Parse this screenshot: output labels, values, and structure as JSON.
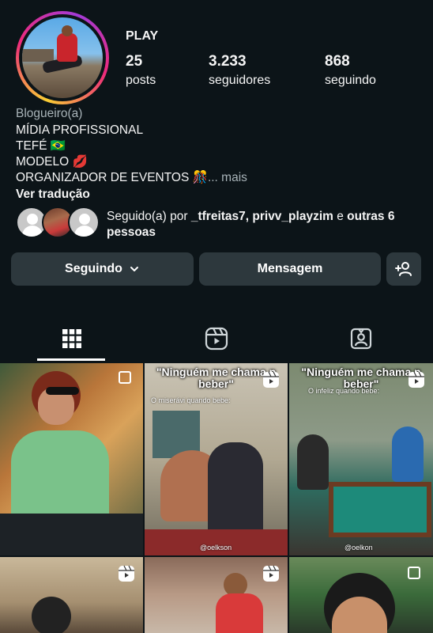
{
  "profile": {
    "username": "PLAY",
    "stats": [
      {
        "value": "25",
        "label": "posts"
      },
      {
        "value": "3.233",
        "label": "seguidores"
      },
      {
        "value": "868",
        "label": "seguindo"
      }
    ],
    "category": "Blogueiro(a)",
    "bio_lines": [
      "MÍDIA PROFISSIONAL",
      "TEFÉ 🇧🇷",
      "MODELO 💋",
      "ORGANIZADOR DE EVENTOS 🎊"
    ],
    "more": "... mais",
    "translate": "Ver tradução"
  },
  "followed_by": {
    "prefix": "Seguido(a) por ",
    "names": "_tfreitas7, privv_playzim",
    "middle": " e ",
    "others": "outras 6 pessoas"
  },
  "actions": {
    "following_label": "Seguindo",
    "message_label": "Mensagem"
  },
  "tabs": [
    "grid-icon",
    "reels-icon",
    "tagged-icon"
  ],
  "posts": [
    {
      "caption": "",
      "sub": "",
      "watermark": ""
    },
    {
      "caption": "\"Ninguém me chama p beber\"",
      "sub": "O miserávi quando bebe:",
      "watermark": "@oelkson"
    },
    {
      "caption": "\"Ninguém me chama p beber\"",
      "sub": "O infeliz quando bebe:",
      "watermark": "@oelkon"
    }
  ],
  "colors": {
    "background": "#0c1418",
    "button": "#2d383d",
    "muted_text": "#a8b3b8"
  }
}
